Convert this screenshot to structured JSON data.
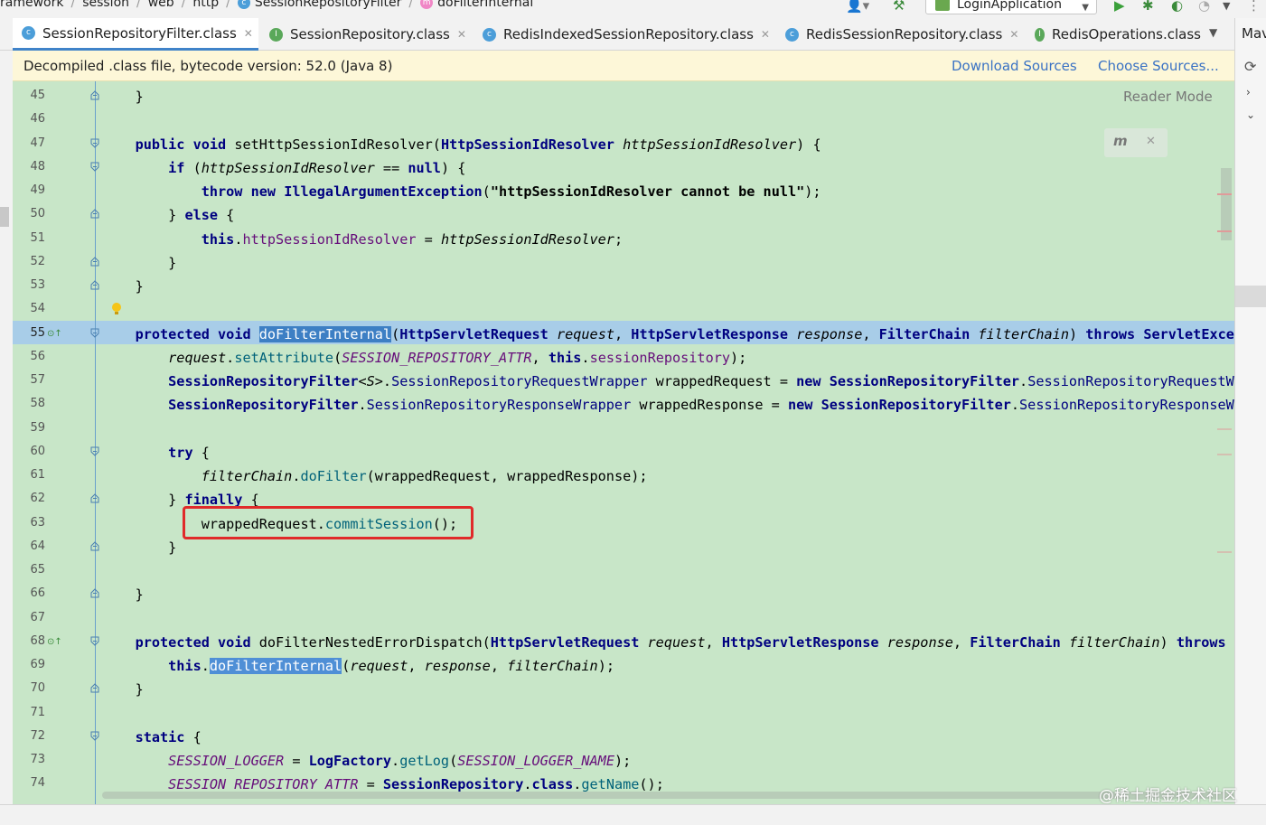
{
  "breadcrumb": {
    "items": [
      {
        "label": "ramework",
        "icon": ""
      },
      {
        "label": "session",
        "icon": ""
      },
      {
        "label": "web",
        "icon": ""
      },
      {
        "label": "http",
        "icon": ""
      },
      {
        "label": "SessionRepositoryFilter",
        "icon": "class-icon"
      },
      {
        "label": "doFilterInternal",
        "icon": "method-icon"
      }
    ],
    "run_config": "LoginApplication"
  },
  "tabs": [
    {
      "label": "SessionRepositoryFilter.class",
      "kind": "class",
      "active": true
    },
    {
      "label": "SessionRepository.class",
      "kind": "interface",
      "active": false
    },
    {
      "label": "RedisIndexedSessionRepository.class",
      "kind": "class",
      "active": false
    },
    {
      "label": "RedisSessionRepository.class",
      "kind": "class",
      "active": false
    },
    {
      "label": "RedisOperations.class",
      "kind": "interface",
      "active": false
    }
  ],
  "right_panel_label": "Mav",
  "banner": {
    "text": "Decompiled .class file, bytecode version: 52.0 (Java 8)",
    "download_sources": "Download Sources",
    "choose_sources": "Choose Sources..."
  },
  "editor": {
    "reader_mode": "Reader Mode",
    "current_line": 55,
    "lines": [
      {
        "n": "45",
        "text": "    }"
      },
      {
        "n": "46",
        "text": ""
      },
      {
        "n": "47",
        "text": "    public void setHttpSessionIdResolver(HttpSessionIdResolver httpSessionIdResolver) {"
      },
      {
        "n": "48",
        "text": "        if (httpSessionIdResolver == null) {"
      },
      {
        "n": "49",
        "text": "            throw new IllegalArgumentException(\"httpSessionIdResolver cannot be null\");"
      },
      {
        "n": "50",
        "text": "        } else {"
      },
      {
        "n": "51",
        "text": "            this.httpSessionIdResolver = httpSessionIdResolver;"
      },
      {
        "n": "52",
        "text": "        }"
      },
      {
        "n": "53",
        "text": "    }"
      },
      {
        "n": "54",
        "text": ""
      },
      {
        "n": "55",
        "text": "    protected void doFilterInternal(HttpServletRequest request, HttpServletResponse response, FilterChain filterChain) throws ServletExcept"
      },
      {
        "n": "56",
        "text": "        request.setAttribute(SESSION_REPOSITORY_ATTR, this.sessionRepository);"
      },
      {
        "n": "57",
        "text": "        SessionRepositoryFilter<S>.SessionRepositoryRequestWrapper wrappedRequest = new SessionRepositoryFilter.SessionRepositoryRequestWra"
      },
      {
        "n": "58",
        "text": "        SessionRepositoryFilter.SessionRepositoryResponseWrapper wrappedResponse = new SessionRepositoryFilter.SessionRepositoryResponseWra"
      },
      {
        "n": "59",
        "text": ""
      },
      {
        "n": "60",
        "text": "        try {"
      },
      {
        "n": "61",
        "text": "            filterChain.doFilter(wrappedRequest, wrappedResponse);"
      },
      {
        "n": "62",
        "text": "        } finally {"
      },
      {
        "n": "63",
        "text": "            wrappedRequest.commitSession();"
      },
      {
        "n": "64",
        "text": "        }"
      },
      {
        "n": "65",
        "text": ""
      },
      {
        "n": "66",
        "text": "    }"
      },
      {
        "n": "67",
        "text": ""
      },
      {
        "n": "68",
        "text": "    protected void doFilterNestedErrorDispatch(HttpServletRequest request, HttpServletResponse response, FilterChain filterChain) throws Se"
      },
      {
        "n": "69",
        "text": "        this.doFilterInternal(request, response, filterChain);"
      },
      {
        "n": "70",
        "text": "    }"
      },
      {
        "n": "71",
        "text": ""
      },
      {
        "n": "72",
        "text": "    static {"
      },
      {
        "n": "73",
        "text": "        SESSION_LOGGER = LogFactory.getLog(SESSION_LOGGER_NAME);"
      },
      {
        "n": "74",
        "text": "        SESSION_REPOSITORY_ATTR = SessionRepository.class.getName();"
      }
    ]
  },
  "watermark": "@稀土掘金技术社区"
}
